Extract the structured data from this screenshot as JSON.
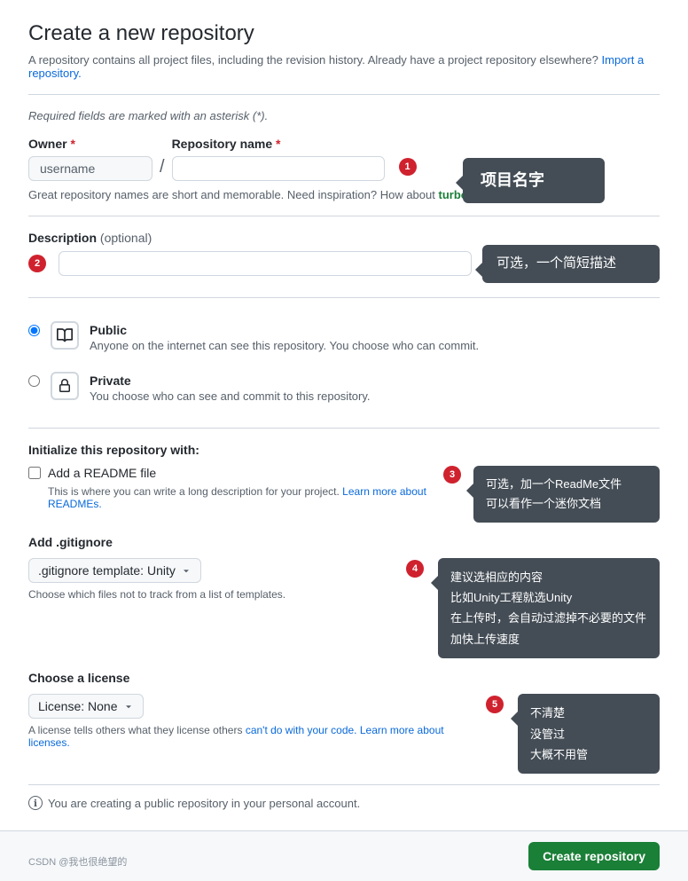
{
  "page": {
    "title": "Create a new repository",
    "subtitle": "A repository contains all project files, including the revision history. Already have a project repository elsewhere?",
    "import_link": "Import a repository.",
    "required_note": "Required fields are marked with an asterisk (*).",
    "name_suggestion": "Great repository names are short and memorable. Need inspiration? How about",
    "suggestion_name": "turbo-octo-waddle",
    "suggestion_end": "?"
  },
  "owner": {
    "label": "Owner",
    "required": "*",
    "placeholder": "username"
  },
  "repo_name": {
    "label": "Repository name",
    "required": "*",
    "value": ""
  },
  "description": {
    "label": "Description",
    "optional": "(optional)",
    "placeholder": ""
  },
  "tooltips": {
    "1": "项目名字",
    "2": "可选，一个简短描述",
    "3_line1": "可选，加一个ReadMe文件",
    "3_line2": "可以看作一个迷你文档",
    "4_line1": "建议选相应的内容",
    "4_line2": "比如Unity工程就选Unity",
    "4_line3": "在上传时，会自动过滤掉不必要的文件",
    "4_line4": "加快上传速度",
    "5_line1": "不清楚",
    "5_line2": "没管过",
    "5_line3": "大概不用管"
  },
  "visibility": {
    "public_label": "Public",
    "public_desc": "Anyone on the internet can see this repository. You choose who can commit.",
    "private_label": "Private",
    "private_desc": "You choose who can see and commit to this repository."
  },
  "initialize": {
    "label": "Initialize this repository with:",
    "readme_label": "Add a README file",
    "readme_desc": "This is where you can write a long description for your project.",
    "readme_link": "Learn more about READMEs."
  },
  "gitignore": {
    "label": "Add .gitignore",
    "dropdown_label": ".gitignore template: Unity",
    "helper": "Choose which files not to track from a list of templates."
  },
  "license": {
    "label": "Choose a license",
    "dropdown_label": "License: None",
    "helper_prefix": "A license tells others what they",
    "helper_link_text": "can't do with your code.",
    "helper_suffix": "Learn more about licenses.",
    "license_others": "license others"
  },
  "info": {
    "message": "You are creating a public repository in your personal account."
  },
  "footer": {
    "create_button": "Create repository",
    "watermark": "CSDN @我也很绝望的"
  },
  "badges": {
    "1": "1",
    "2": "2",
    "3": "3",
    "4": "4",
    "5": "5"
  }
}
